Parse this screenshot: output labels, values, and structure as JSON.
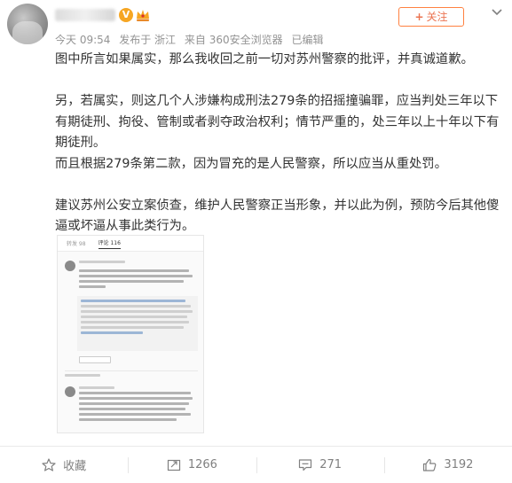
{
  "header": {
    "vip_badge": "V",
    "meta": {
      "time": "今天 09:54",
      "location": "发布于 浙江",
      "source": "来自 360安全浏览器",
      "edited": "已编辑"
    },
    "follow_label": "关注",
    "follow_plus": "+"
  },
  "post": {
    "paragraphs": [
      "图中所言如果属实，那么我收回之前一切对苏州警察的批评，并真诚道歉。",
      "",
      "另，若属实，则这几个人涉嫌构成刑法279条的招摇撞骗罪，应当判处三年以下有期徒刑、拘役、管制或者剥夺政治权利；情节严重的，处三年以上十年以下有期徒刑。",
      "而且根据279条第二款，因为冒充的是人民警察，所以应当从重处罚。",
      "",
      "建议苏州公安立案侦查，维护人民警察正当形象，并以此为例，预防今后其他傻逼或坏逼从事此类行为。"
    ]
  },
  "screenshot": {
    "tab_repost": "转发 98",
    "tab_comment": "评论 116"
  },
  "actions": {
    "favorite": "收藏",
    "repost": "1266",
    "comment": "271",
    "like": "3192"
  },
  "colors": {
    "accent": "#eb7350",
    "follow_border": "#ff8140",
    "meta": "#939393",
    "vip": "#f6a623"
  }
}
